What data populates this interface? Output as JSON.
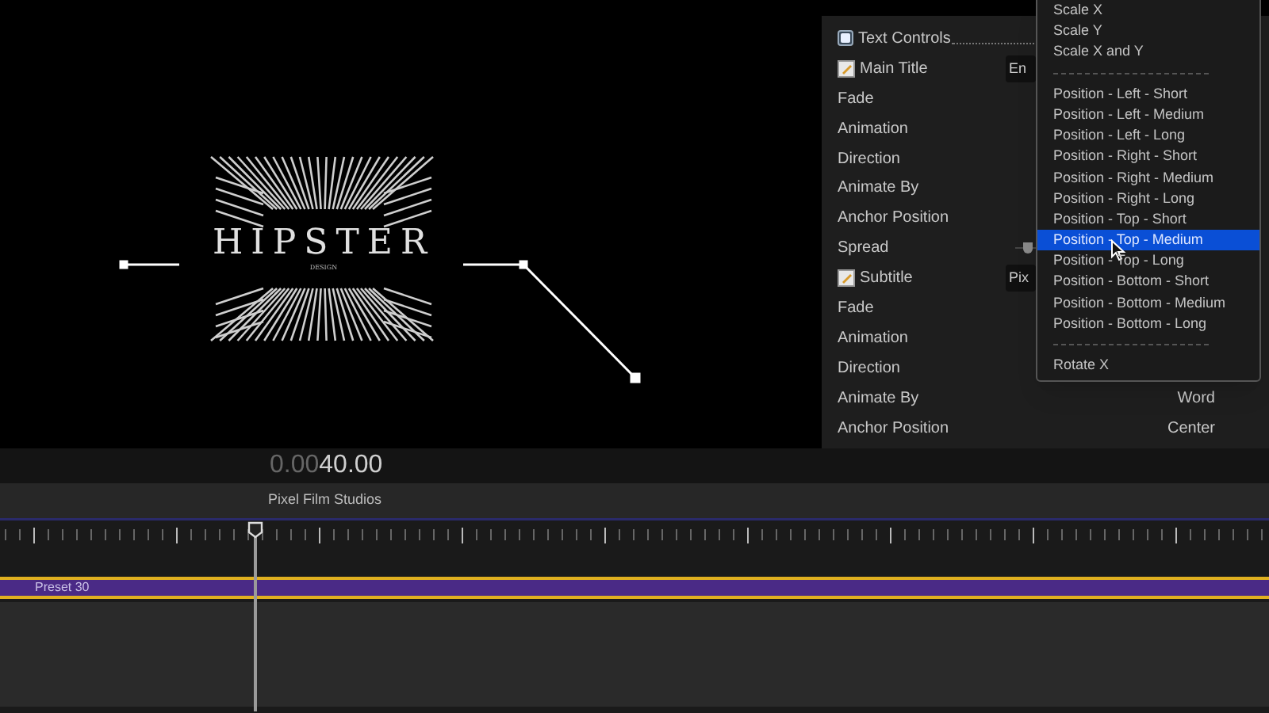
{
  "preview": {
    "logo": {
      "title": "HIPSTER",
      "subtitle": "DESIGN"
    }
  },
  "inspector": {
    "rows": [
      {
        "kind": "group",
        "label": "Text Controls",
        "checked": true
      },
      {
        "kind": "text",
        "label": "Main Title",
        "value": "En"
      },
      {
        "kind": "param",
        "label": "Fade"
      },
      {
        "kind": "param",
        "label": "Animation"
      },
      {
        "kind": "param",
        "label": "Direction"
      },
      {
        "kind": "param",
        "label": "Animate By"
      },
      {
        "kind": "param",
        "label": "Anchor Position"
      },
      {
        "kind": "slider",
        "label": "Spread",
        "level": 0.05
      },
      {
        "kind": "text",
        "label": "Subtitle",
        "value": "Pix"
      },
      {
        "kind": "param",
        "label": "Fade"
      },
      {
        "kind": "param",
        "label": "Animation"
      },
      {
        "kind": "param",
        "label": "Direction"
      },
      {
        "kind": "param",
        "label": "Animate By",
        "value": "Word"
      },
      {
        "kind": "param",
        "label": "Anchor Position",
        "value": "Center"
      }
    ]
  },
  "menu": {
    "items": [
      {
        "kind": "item",
        "label": "Scale X",
        "selected": false
      },
      {
        "kind": "item",
        "label": "Scale Y",
        "selected": false
      },
      {
        "kind": "item",
        "label": "Scale X and Y",
        "selected": false
      },
      {
        "kind": "separator"
      },
      {
        "kind": "item",
        "label": "Position - Left - Short",
        "selected": false
      },
      {
        "kind": "item",
        "label": "Position - Left - Medium",
        "selected": false
      },
      {
        "kind": "item",
        "label": "Position - Left - Long",
        "selected": false
      },
      {
        "kind": "item",
        "label": "Position - Right - Short",
        "selected": false
      },
      {
        "kind": "item",
        "label": "Position - Right - Medium",
        "selected": false
      },
      {
        "kind": "item",
        "label": "Position - Right - Long",
        "selected": false
      },
      {
        "kind": "item",
        "label": "Position - Top - Short",
        "selected": false
      },
      {
        "kind": "item",
        "label": "Position - Top - Medium",
        "selected": true
      },
      {
        "kind": "item",
        "label": "Position - Top - Long",
        "selected": false
      },
      {
        "kind": "item",
        "label": "Position - Bottom - Short",
        "selected": false
      },
      {
        "kind": "item",
        "label": "Position - Bottom - Medium",
        "selected": false
      },
      {
        "kind": "item",
        "label": "Position - Bottom - Long",
        "selected": false
      },
      {
        "kind": "separator"
      },
      {
        "kind": "item",
        "label": "Rotate X",
        "selected": false
      }
    ]
  },
  "timeline": {
    "timecode": {
      "prefix": "0.00",
      "value": "40.00"
    },
    "project": "Pixel Film Studios",
    "clip": {
      "label": "Preset 30",
      "selected": true
    }
  }
}
